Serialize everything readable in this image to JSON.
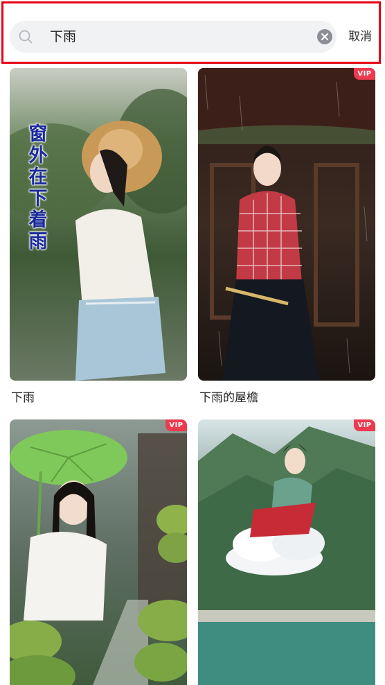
{
  "search": {
    "query": "下雨",
    "cancel_label": "取消"
  },
  "colors": {
    "highlight_border": "#e60012",
    "vip_badge": "#ec3b4f"
  },
  "results": [
    {
      "caption": "下雨",
      "overlay_text": "窗外在下着雨",
      "vip": false
    },
    {
      "caption": "下雨的屋檐",
      "vip": true,
      "badge": "VIP"
    },
    {
      "caption": "",
      "vip": true,
      "badge": "VIP"
    },
    {
      "caption": "",
      "vip": true,
      "badge": "VIP"
    }
  ]
}
